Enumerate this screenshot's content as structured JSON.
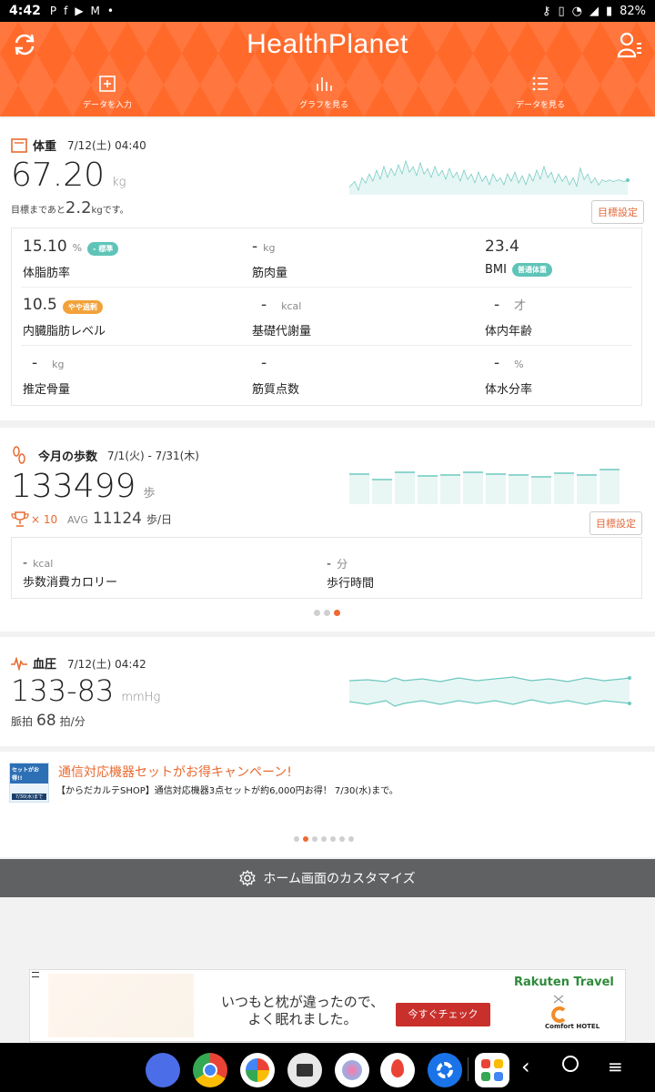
{
  "status": {
    "time": "4:42",
    "icons": [
      "P",
      "f",
      "▶",
      "M",
      "•"
    ],
    "battery": "82%"
  },
  "header": {
    "title": "HealthPlanet",
    "nav": [
      {
        "label": "データを入力"
      },
      {
        "label": "グラフを見る"
      },
      {
        "label": "データを見る"
      }
    ]
  },
  "weight": {
    "title": "体重",
    "date": "7/12(土) 04:40",
    "value": "67.20",
    "unit": "kg",
    "goal_prefix": "目標まであと",
    "goal_value": "2.2",
    "goal_unit": "kg",
    "goal_suffix": "です。",
    "goal_button": "目標設定",
    "metrics": [
      {
        "value": "15.10",
        "unit": "%",
        "label": "体脂肪率",
        "badge": "- 標準",
        "badge_color": "#5fc4b8"
      },
      {
        "value": "-",
        "unit": "kg",
        "label": "筋肉量"
      },
      {
        "value": "23.4",
        "unit": "",
        "label": "BMI",
        "badge": "普通体重",
        "badge_color": "#5fc4b8"
      },
      {
        "value": "10.5",
        "unit": "",
        "label": "内臓脂肪レベル",
        "badge": "やや過剰",
        "badge_color": "#f2a23a"
      },
      {
        "value": "-",
        "unit": "kcal",
        "label": "基礎代謝量"
      },
      {
        "value": "-",
        "unit": "才",
        "label": "体内年齢"
      },
      {
        "value": "-",
        "unit": "kg",
        "label": "推定骨量"
      },
      {
        "value": "-",
        "unit": "",
        "label": "筋質点数"
      },
      {
        "value": "-",
        "unit": "%",
        "label": "体水分率"
      }
    ]
  },
  "steps": {
    "title": "今月の歩数",
    "date": "7/1(火) - 7/31(木)",
    "value": "133499",
    "unit": "歩",
    "trophy": "× 10",
    "avg_label": "AVG",
    "avg_value": "11124",
    "avg_unit": "歩/日",
    "goal_button": "目標設定",
    "metrics": [
      {
        "value": "-",
        "unit": "kcal",
        "label": "歩数消費カロリー"
      },
      {
        "value": "-",
        "unit": "分",
        "label": "歩行時間"
      }
    ]
  },
  "bp": {
    "title": "血圧",
    "date": "7/12(土) 04:42",
    "value": "133-83",
    "unit": "mmHg",
    "pulse_label": "脈拍",
    "pulse_value": "68",
    "pulse_unit": "拍/分"
  },
  "banner": {
    "title": "通信対応機器セットがお得キャンペーン!",
    "text": "【からだカルテSHOP】通信対応機器3点セットが約6,000円お得！ 7/30(水)まで。",
    "thumb_text": "セットがお得!!",
    "thumb_sub": "7/30(水)まで"
  },
  "customize": {
    "label": "ホーム画面のカスタマイズ"
  },
  "ad": {
    "line1": "いつもと枕が違ったので、",
    "line2": "よく眠れました。",
    "cta": "今すぐチェック",
    "brand": "Rakuten Travel",
    "brand2": "Comfort HOTEL"
  },
  "colors": {
    "accent": "#ff6a2b",
    "teal": "#5fc4b8",
    "orange": "#f2a23a"
  }
}
